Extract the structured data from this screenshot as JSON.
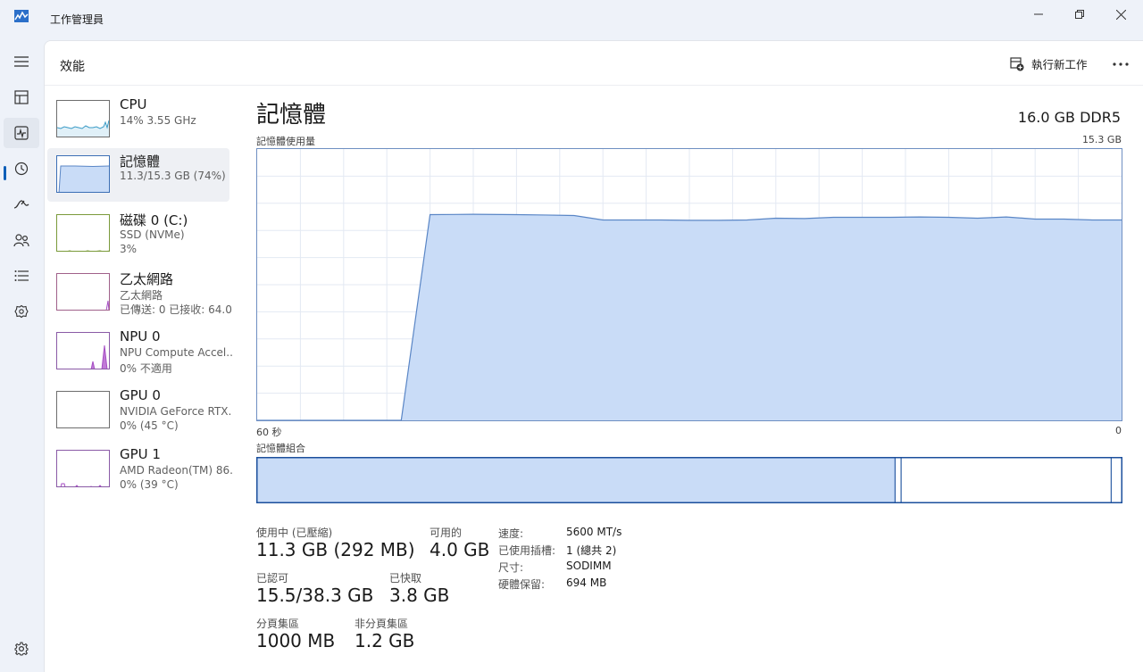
{
  "window": {
    "title": "工作管理員"
  },
  "colors": {
    "accent": "#0f5fb8",
    "memory_fill": "#c9dcf7",
    "memory_line": "#5a86c6",
    "grid": "#e3e9f3",
    "cpu_line": "#3a9bc6",
    "gpu_purple": "#a64ec4"
  },
  "rail": {
    "items": [
      {
        "icon": "hamburger-menu-icon"
      },
      {
        "icon": "processes-icon"
      },
      {
        "icon": "performance-icon",
        "active": true
      },
      {
        "icon": "app-history-icon"
      },
      {
        "icon": "startup-apps-icon"
      },
      {
        "icon": "users-icon"
      },
      {
        "icon": "details-icon"
      },
      {
        "icon": "services-icon"
      }
    ],
    "settings_icon": "settings-gear-icon"
  },
  "header": {
    "title": "效能",
    "run_new_task": "執行新工作",
    "more_icon": "more-options-icon"
  },
  "sidebar": {
    "items": [
      {
        "title": "CPU",
        "line1": "14%  3.55 GHz",
        "line2": ""
      },
      {
        "title": "記憶體",
        "line1": "11.3/15.3 GB (74%)",
        "line2": ""
      },
      {
        "title": "磁碟 0 (C:)",
        "line1": "SSD (NVMe)",
        "line2": "3%"
      },
      {
        "title": "乙太網路",
        "line1": "乙太網路",
        "line2": "已傳送: 0  已接收: 64.0"
      },
      {
        "title": "NPU 0",
        "line1": "NPU Compute Accel...",
        "line2": "0%  不適用"
      },
      {
        "title": "GPU 0",
        "line1": "NVIDIA GeForce RTX...",
        "line2": "0% (45 °C)"
      },
      {
        "title": "GPU 1",
        "line1": "AMD Radeon(TM) 86...",
        "line2": "0% (39 °C)"
      }
    ]
  },
  "detail": {
    "title": "記憶體",
    "spec": "16.0 GB DDR5",
    "usage_label": "記憶體使用量",
    "usage_max": "15.3 GB",
    "time_left": "60 秒",
    "time_right": "0",
    "composition_label": "記憶體組合",
    "composition": {
      "in_use_fraction": 0.738,
      "modified_fraction": 0.007,
      "standby_fraction": 0.243
    },
    "stats": {
      "in_use_label": "使用中 (已壓縮)",
      "in_use_value": "11.3 GB (292 MB)",
      "available_label": "可用的",
      "available_value": "4.0 GB",
      "committed_label": "已認可",
      "committed_value": "15.5/38.3 GB",
      "cached_label": "已快取",
      "cached_value": "3.8 GB",
      "paged_label": "分頁集區",
      "paged_value": "1000 MB",
      "nonpaged_label": "非分頁集區",
      "nonpaged_value": "1.2 GB"
    },
    "props": [
      {
        "key": "速度:",
        "value": "5600 MT/s"
      },
      {
        "key": "已使用插槽:",
        "value": "1 (總共 2)"
      },
      {
        "key": "尺寸:",
        "value": "SODIMM"
      },
      {
        "key": "硬體保留:",
        "value": "694 MB"
      }
    ]
  },
  "chart_data": {
    "type": "area",
    "x": [
      60,
      50,
      48,
      45,
      42,
      40,
      38,
      36,
      34,
      32,
      30,
      28,
      26,
      24,
      22,
      20,
      18,
      16,
      14,
      12,
      10,
      8,
      6,
      4,
      2,
      0
    ],
    "values": [
      0,
      0,
      11.6,
      11.62,
      11.6,
      11.58,
      11.55,
      11.3,
      11.3,
      11.3,
      11.28,
      11.28,
      11.3,
      11.4,
      11.38,
      11.45,
      11.45,
      11.45,
      11.47,
      11.45,
      11.4,
      11.47,
      11.35,
      11.35,
      11.3,
      11.3
    ],
    "ylim": [
      0,
      15.3
    ],
    "xlim": [
      60,
      0
    ],
    "grid": true
  }
}
